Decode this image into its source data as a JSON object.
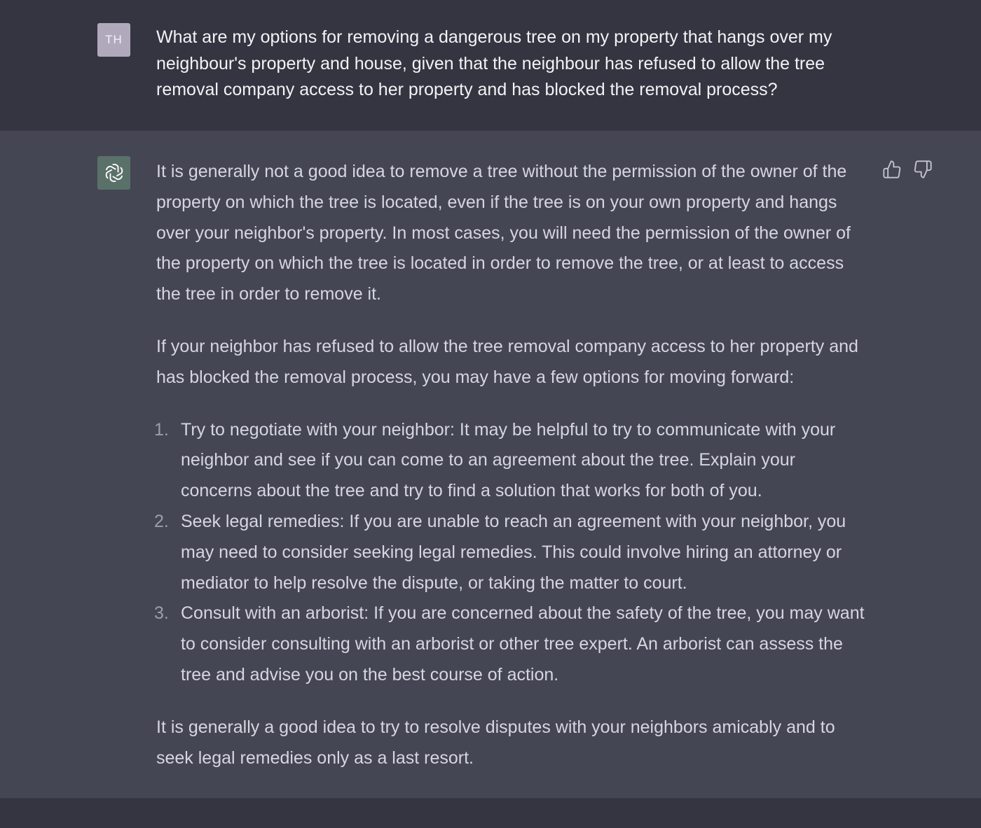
{
  "user_message": {
    "avatar_initials": "TH",
    "text": "What are my options for removing a dangerous tree on my property that hangs over my neighbour's property and house, given that the neighbour has refused to allow the tree removal company access to her property and has blocked the removal process?"
  },
  "assistant_message": {
    "avatar_icon": "openai-logo-icon",
    "intro_1": "It is generally not a good idea to remove a tree without the permission of the owner of the property on which the tree is located, even if the tree is on your own property and hangs over your neighbor's property. In most cases, you will need the permission of the owner of the property on which the tree is located in order to remove the tree, or at least to access the tree in order to remove it.",
    "intro_2": "If your neighbor has refused to allow the tree removal company access to her property and has blocked the removal process, you may have a few options for moving forward:",
    "options": [
      {
        "number": "1.",
        "text": "Try to negotiate with your neighbor: It may be helpful to try to communicate with your neighbor and see if you can come to an agreement about the tree. Explain your concerns about the tree and try to find a solution that works for both of you."
      },
      {
        "number": "2.",
        "text": "Seek legal remedies: If you are unable to reach an agreement with your neighbor, you may need to consider seeking legal remedies. This could involve hiring an attorney or mediator to help resolve the dispute, or taking the matter to court."
      },
      {
        "number": "3.",
        "text": "Consult with an arborist: If you are concerned about the safety of the tree, you may want to consider consulting with an arborist or other tree expert. An arborist can assess the tree and advise you on the best course of action."
      }
    ],
    "conclusion": "It is generally a good idea to try to resolve disputes with your neighbors amicably and to seek legal remedies only as a last resort."
  },
  "feedback": {
    "up_icon": "thumbs-up-icon",
    "down_icon": "thumbs-down-icon"
  },
  "colors": {
    "user_bg": "#343541",
    "assistant_bg": "#444654",
    "user_avatar": "#b0a9bc",
    "ai_avatar": "#5a7169"
  }
}
